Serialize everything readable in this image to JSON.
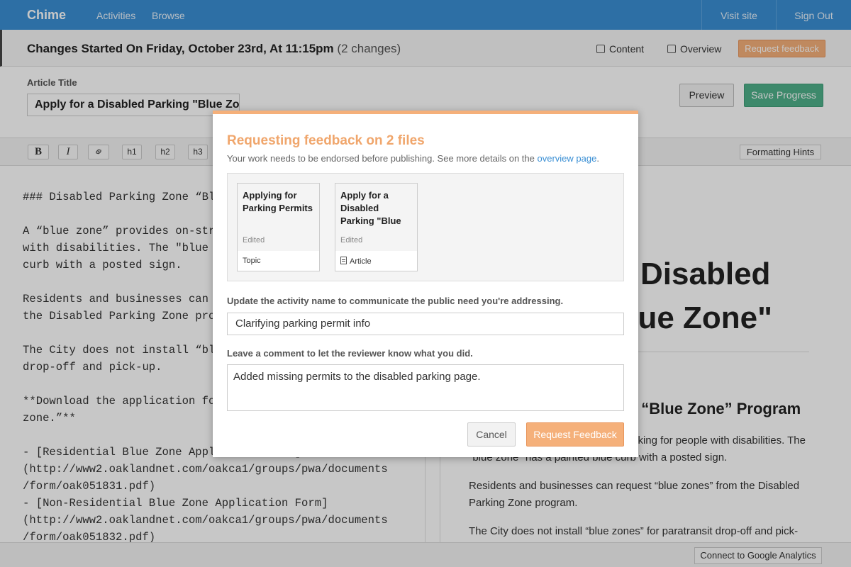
{
  "nav": {
    "brand": "Chime",
    "links": [
      "Activities",
      "Browse"
    ],
    "visit_site": "Visit site",
    "sign_out": "Sign Out"
  },
  "changes_bar": {
    "title": "Changes Started On Friday, October 23rd, At 11:15pm",
    "count": "(2 changes)",
    "content_label": "Content",
    "overview_label": "Overview",
    "request_feedback_label": "Request feedback"
  },
  "title_area": {
    "label": "Article Title",
    "value": "Apply for a Disabled Parking \"Blue Zone\"",
    "preview_label": "Preview",
    "save_label": "Save Progress"
  },
  "toolbar": {
    "buttons": [
      "B",
      "I",
      "link",
      "h1",
      "h2",
      "h3"
    ],
    "hints_label": "Formatting Hints"
  },
  "editor": {
    "text": "### Disabled Parking Zone “Blue Zone” Program\n\nA “blue zone” provides on-street parking for people\nwith disabilities. The \"blue zone\" has a painted blue\ncurb with a posted sign.\n\nResidents and businesses can request “blue zones” from\nthe Disabled Parking Zone program.\n\nThe City does not install “blue zones” for paratransit\ndrop-off and pick-up.\n\n**Download the application form for a “blue\nzone.”**\n\n- [Residential Blue Zone Application Form]\n(http://www2.oaklandnet.com/oakca1/groups/pwa/documents\n/form/oak051831.pdf)\n- [Non-Residential Blue Zone Application Form]\n(http://www2.oaklandnet.com/oakca1/groups/pwa/documents\n/form/oak051832.pdf)"
  },
  "preview": {
    "heading": "Apply for a Disabled Parking \"Blue Zone\"",
    "subheading": "Disabled Parking Zone “Blue Zone” Program",
    "paragraphs": [
      "A “blue zone” provides on-street parking for people with disabilities. The \"blue zone\" has a painted blue curb with a posted sign.",
      "Residents and businesses can request “blue zones” from the Disabled Parking Zone program.",
      "The City does not install “blue zones” for paratransit drop-off and pick-up."
    ]
  },
  "footer": {
    "ga_label": "Connect to Google Analytics"
  },
  "modal": {
    "title": "Requesting feedback on 2 files",
    "subtitle": "Your work needs to be endorsed before publishing. See more details on the",
    "subtitle_link": "overview page",
    "subtitle_end": ".",
    "files": [
      {
        "name": "Applying for Parking Permits",
        "status": "Edited",
        "type": "Topic"
      },
      {
        "name": "Apply for a Disabled Parking \"Blue",
        "status": "Edited",
        "type": "Article"
      }
    ],
    "activity_label": "Update the activity name to communicate the public need you're addressing.",
    "activity_value": "Clarifying parking permit info",
    "comment_label": "Leave a comment to let the reviewer know what you did.",
    "comment_value": "Added missing permits to the disabled parking page.",
    "cancel_label": "Cancel",
    "submit_label": "Request Feedback"
  },
  "colors": {
    "nav_blue": "#3a8fd4",
    "accent_orange": "#f5b07a",
    "save_green": "#4fb08a"
  }
}
